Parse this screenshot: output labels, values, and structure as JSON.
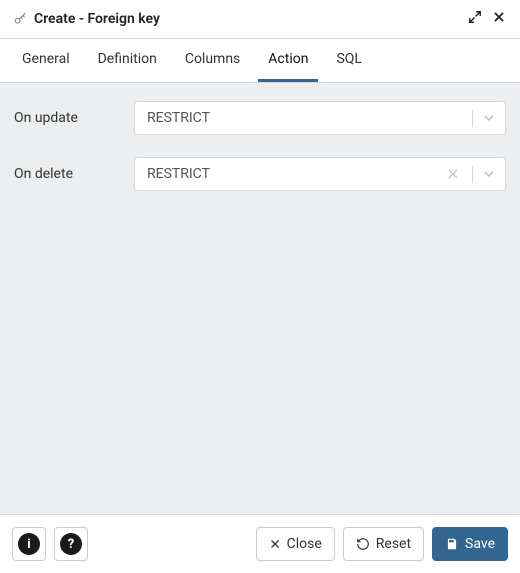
{
  "header": {
    "title": "Create - Foreign key"
  },
  "tabs": [
    {
      "label": "General",
      "active": false
    },
    {
      "label": "Definition",
      "active": false
    },
    {
      "label": "Columns",
      "active": false
    },
    {
      "label": "Action",
      "active": true
    },
    {
      "label": "SQL",
      "active": false
    }
  ],
  "form": {
    "on_update": {
      "label": "On update",
      "value": "RESTRICT",
      "clearable": false
    },
    "on_delete": {
      "label": "On delete",
      "value": "RESTRICT",
      "clearable": true
    }
  },
  "footer": {
    "close_label": "Close",
    "reset_label": "Reset",
    "save_label": "Save"
  }
}
